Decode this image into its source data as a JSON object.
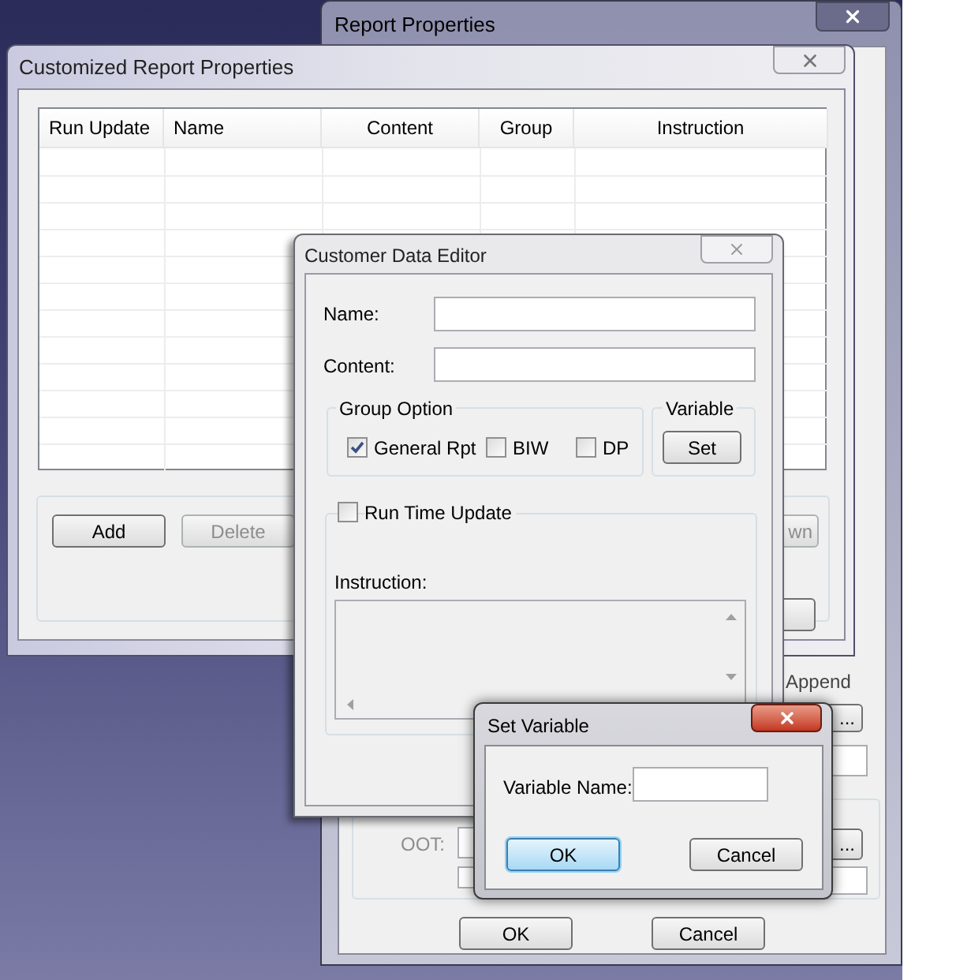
{
  "report_properties": {
    "title": "Report Properties",
    "append_label": "Append",
    "oot_label": "OOT:",
    "browse_buttons": [
      "...",
      "..."
    ],
    "buttons": [
      "OK",
      "Cancel"
    ]
  },
  "customized": {
    "title": "Customized Report Properties",
    "columns": [
      "Run Update",
      "Name",
      "Content",
      "Group",
      "Instruction"
    ],
    "buttons": [
      {
        "label": "Add",
        "disabled": false
      },
      {
        "label": "Delete",
        "disabled": true
      },
      {
        "label": "wn",
        "disabled": true
      }
    ]
  },
  "editor": {
    "title": "Customer Data Editor",
    "name_label": "Name:",
    "content_label": "Content:",
    "group_title": "Group Option",
    "groups": [
      {
        "label": "General Rpt",
        "checked": true
      },
      {
        "label": "BIW",
        "checked": false
      },
      {
        "label": "DP",
        "checked": false
      }
    ],
    "variable_title": "Variable",
    "set_button": "Set",
    "run_time": {
      "label": "Run Time Update",
      "checked": false
    },
    "instruction_label": "Instruction:"
  },
  "set_variable": {
    "title": "Set Variable",
    "field_label": "Variable Name:",
    "buttons": [
      {
        "label": "OK",
        "selected": true
      },
      {
        "label": "Cancel",
        "selected": false
      }
    ]
  }
}
